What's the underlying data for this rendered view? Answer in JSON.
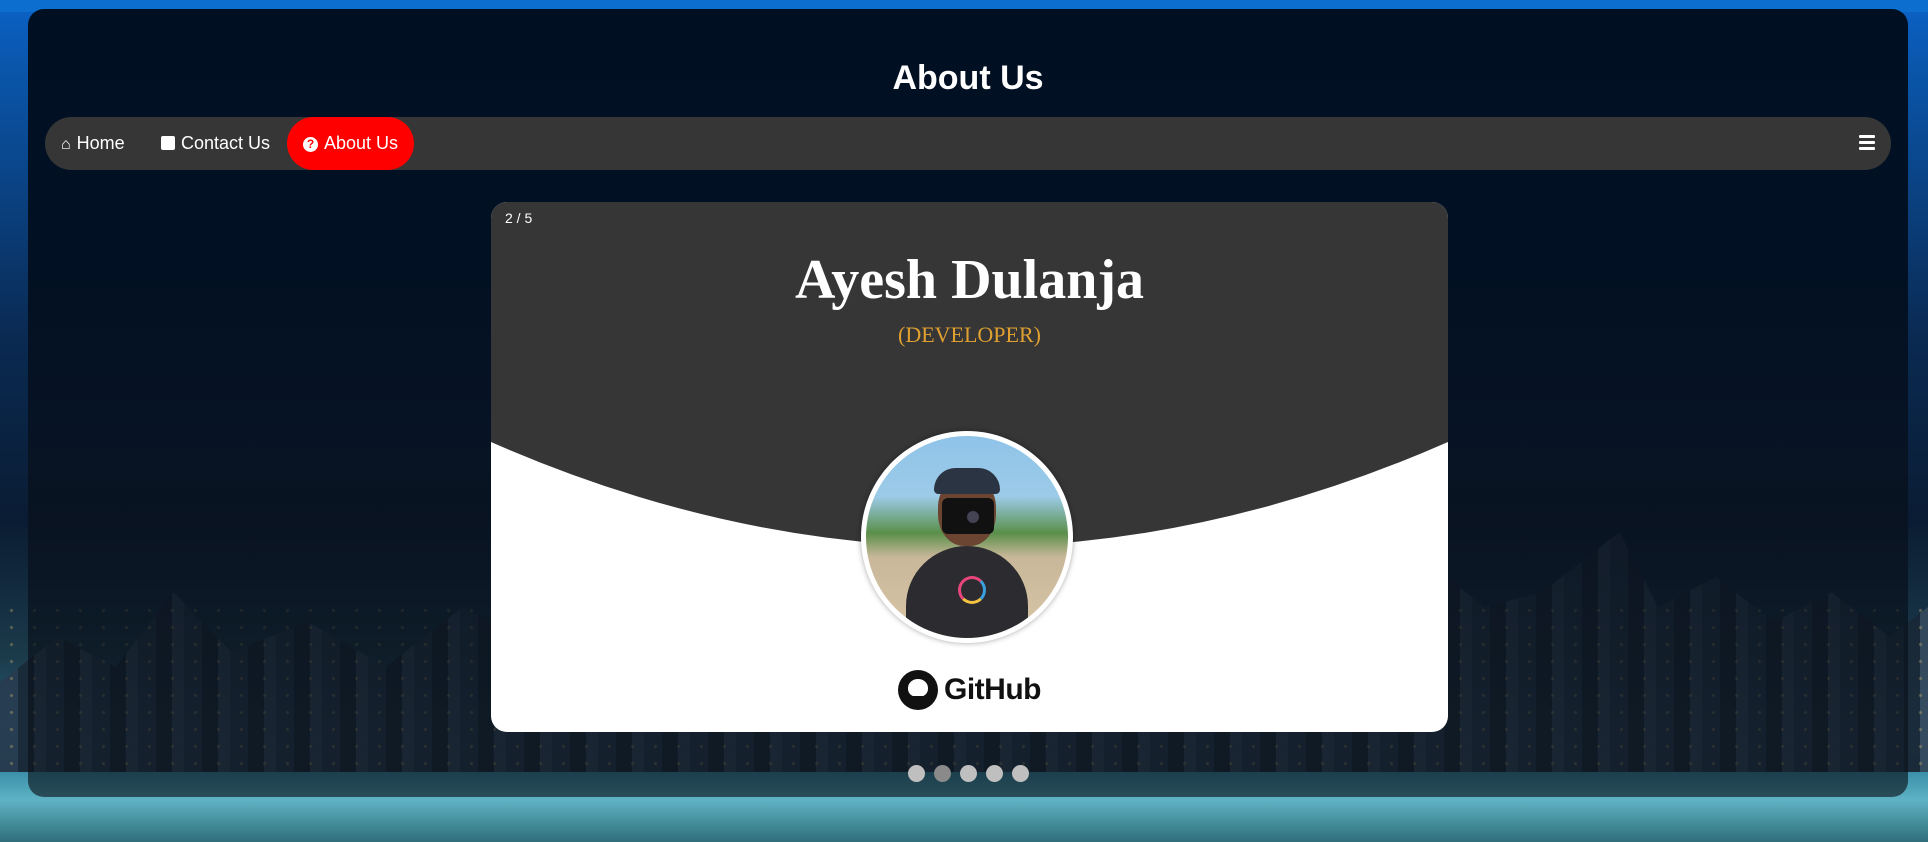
{
  "page": {
    "title": "About Us"
  },
  "nav": {
    "items": [
      {
        "label": "Home",
        "icon": "home-icon"
      },
      {
        "label": "Contact Us",
        "icon": "phone-icon"
      },
      {
        "label": "About Us",
        "icon": "question-icon",
        "active": true
      }
    ],
    "menu_icon": "hamburger-icon"
  },
  "slide": {
    "counter": "2 / 5",
    "name": "Ayesh Dulanja",
    "role": "(DEVELOPER)",
    "link_label": "GitHub",
    "link_icon": "github-icon"
  },
  "carousel": {
    "total": 5,
    "current": 2
  },
  "colors": {
    "nav_bg": "#363636",
    "active": "#ff0000",
    "role": "#e0a030",
    "card_top": "#363636"
  }
}
